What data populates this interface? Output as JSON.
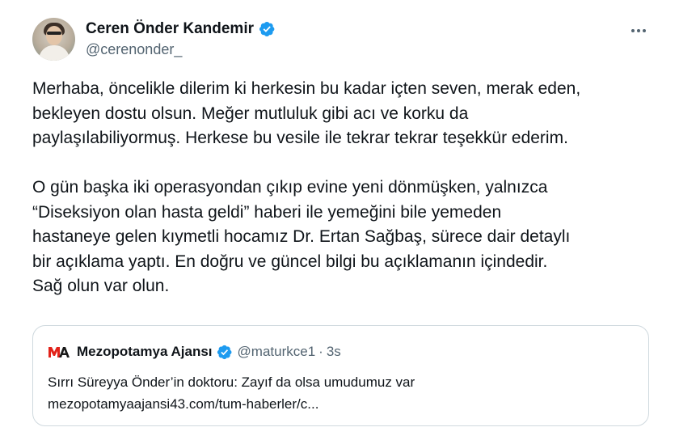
{
  "author": {
    "display_name": "Ceren Önder Kandemir",
    "handle": "@cerenonder_",
    "verified_color": "#1d9bf0"
  },
  "tweet": {
    "paragraphs": [
      [
        "Merhaba, öncelikle dilerim ki herkesin bu kadar içten seven, merak eden,",
        "bekleyen dostu olsun. Meğer mutluluk gibi acı ve korku da",
        "paylaşılabiliyormuş. Herkese bu vesile ile tekrar tekrar teşekkür ederim."
      ],
      [
        "O gün başka iki operasyondan çıkıp evine yeni dönmüşken, yalnızca",
        "“Diseksiyon olan hasta geldi” haberi ile yemeğini bile yemeden",
        "hastaneye gelen kıymetli hocamız Dr. Ertan Sağbaş, sürece dair detaylı",
        "bir açıklama yaptı. En doğru ve güncel bilgi bu açıklamanın içindedir.",
        "Sağ olun var olun."
      ]
    ]
  },
  "quoted_tweet": {
    "logo_text": "MA",
    "name": "Mezopotamya Ajansı",
    "handle": "@maturkce1",
    "separator": "·",
    "time": "3s",
    "text": "Sırrı Süreyya Önder’in doktoru: Zayıf da olsa umudumuz var",
    "link": "mezopotamyaajansi43.com/tum-haberler/c..."
  },
  "icons": {
    "more": "more-horizontal-icon",
    "verified": "verified-badge-icon",
    "logo": "mezopotamya-ajansi-logo"
  },
  "colors": {
    "text": "#0f1419",
    "secondary": "#536471",
    "border": "#cfd9de",
    "logo_red": "#e2231a"
  }
}
